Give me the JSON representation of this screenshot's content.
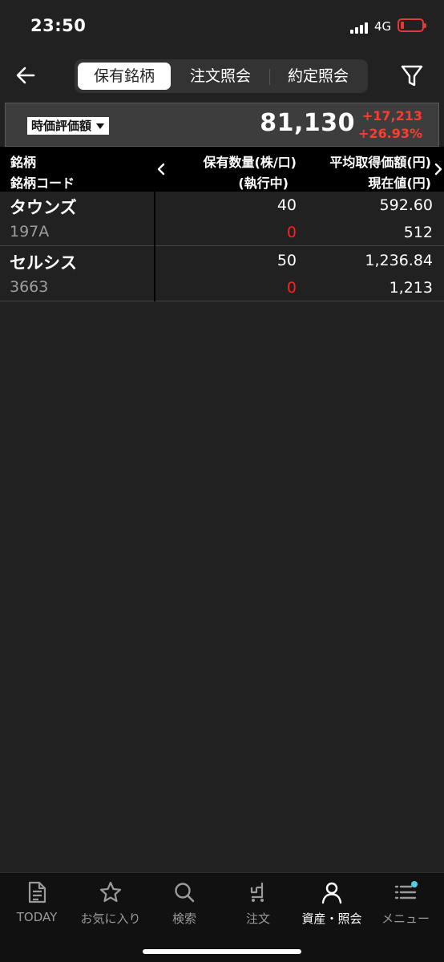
{
  "status_bar": {
    "time": "23:50",
    "network": "4G"
  },
  "header": {
    "tabs": [
      {
        "label": "保有銘柄",
        "active": true
      },
      {
        "label": "注文照会",
        "active": false
      },
      {
        "label": "約定照会",
        "active": false
      }
    ]
  },
  "summary": {
    "dropdown_label": "時価評価額",
    "total_value": "81,130",
    "change_amount": "+17,213",
    "change_percent": "+26.93%"
  },
  "table": {
    "headers": {
      "name": "銘柄",
      "code": "銘柄コード",
      "quantity": "保有数量(株/口)",
      "executing": "(執行中)",
      "avg_price": "平均取得価額(円)",
      "current_price": "現在値(円)"
    },
    "rows": [
      {
        "name": "タウンズ",
        "code": "197A",
        "quantity": "40",
        "executing": "0",
        "avg_price": "592.60",
        "current_price": "512"
      },
      {
        "name": "セルシス",
        "code": "3663",
        "quantity": "50",
        "executing": "0",
        "avg_price": "1,236.84",
        "current_price": "1,213"
      }
    ]
  },
  "tabbar": {
    "items": [
      {
        "label": "TODAY",
        "icon": "document-icon",
        "active": false
      },
      {
        "label": "お気に入り",
        "icon": "star-icon",
        "active": false
      },
      {
        "label": "検索",
        "icon": "search-icon",
        "active": false
      },
      {
        "label": "注文",
        "icon": "cart-icon",
        "active": false
      },
      {
        "label": "資産・照会",
        "icon": "person-icon",
        "active": true
      },
      {
        "label": "メニュー",
        "icon": "menu-icon",
        "active": false
      }
    ]
  },
  "colors": {
    "background": "#212121",
    "positive_change": "#ff3b30",
    "executing_qty": "#ff1f1f",
    "notification_dot": "#4dd0e1"
  }
}
